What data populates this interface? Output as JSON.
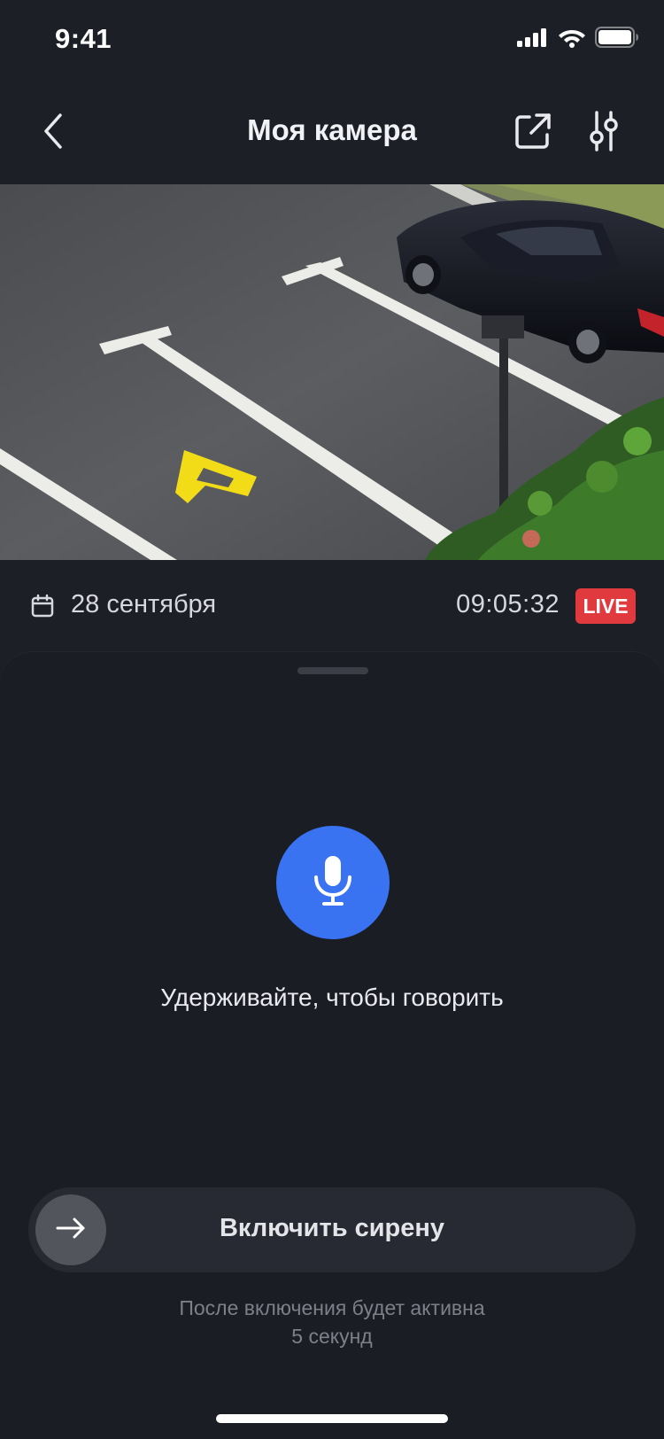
{
  "status_bar": {
    "time": "9:41",
    "icons": [
      "cellular-signal-icon",
      "wifi-icon",
      "battery-icon"
    ]
  },
  "nav": {
    "title": "Моя камера",
    "back_icon": "chevron-left-icon",
    "share_icon": "share-external-icon",
    "settings_icon": "sliders-icon"
  },
  "camera": {
    "scene": "parking-lot-camera-view"
  },
  "info": {
    "date": "28 сентября",
    "time": "09:05:32",
    "live_badge": "LIVE",
    "live_color": "#e03a3e"
  },
  "talk": {
    "hold_label": "Удерживайте, чтобы говорить",
    "button_color": "#3a73f2",
    "icon": "microphone-icon"
  },
  "siren": {
    "label": "Включить сирену",
    "knob_icon": "arrow-right-icon",
    "note_line1": "После включения будет активна",
    "note_line2": "5 секунд"
  }
}
